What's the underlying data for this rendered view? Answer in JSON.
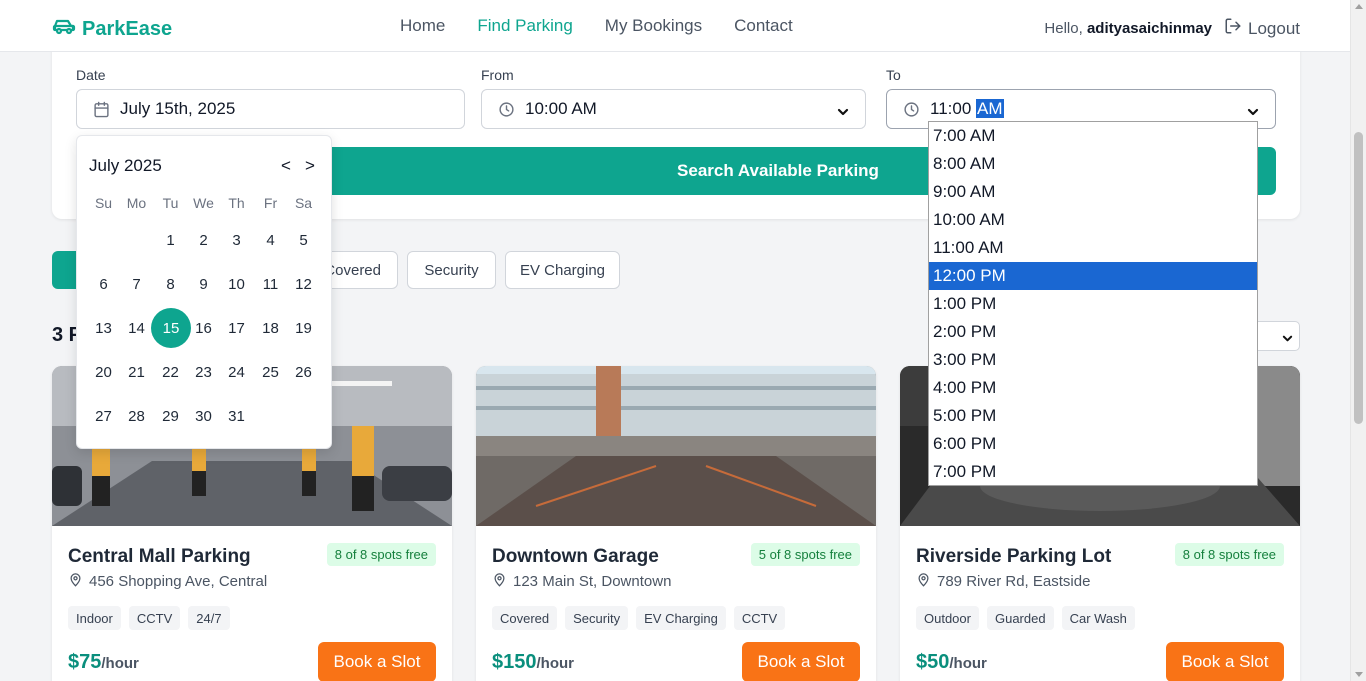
{
  "brand": {
    "name": "ParkEase",
    "icon": "car-icon"
  },
  "nav": {
    "links": [
      "Home",
      "Find Parking",
      "My Bookings",
      "Contact"
    ],
    "active": "Find Parking"
  },
  "user": {
    "greeting": "Hello,",
    "username": "adityasaichinmay",
    "logout": "Logout"
  },
  "search": {
    "date_label": "Date",
    "date_value": "July 15th, 2025",
    "from_label": "From",
    "from_value": "10:00 AM",
    "to_label": "To",
    "to_value_time": "11:00",
    "to_value_period": "AM",
    "button": "Search Available Parking"
  },
  "filters": [
    "Covered",
    "Security",
    "EV Charging"
  ],
  "results": {
    "title_fragment": "3 P"
  },
  "datepicker": {
    "month": "July 2025",
    "prev": "<",
    "next": ">",
    "weekdays": [
      "Su",
      "Mo",
      "Tu",
      "We",
      "Th",
      "Fr",
      "Sa"
    ],
    "first_weekday": 2,
    "days_in_month": 31,
    "selected": 15
  },
  "time_dropdown": {
    "options": [
      "7:00 AM",
      "8:00 AM",
      "9:00 AM",
      "10:00 AM",
      "11:00 AM",
      "12:00 PM",
      "1:00 PM",
      "2:00 PM",
      "3:00 PM",
      "4:00 PM",
      "5:00 PM",
      "6:00 PM",
      "7:00 PM"
    ],
    "highlighted": "12:00 PM"
  },
  "cards": [
    {
      "name": "Central Mall Parking",
      "availability": "8 of 8 spots free",
      "address": "456 Shopping Ave, Central",
      "tags": [
        "Indoor",
        "CCTV",
        "24/7"
      ],
      "price": "$75",
      "unit": "/hour",
      "button": "Book a Slot"
    },
    {
      "name": "Downtown Garage",
      "availability": "5 of 8 spots free",
      "address": "123 Main St, Downtown",
      "tags": [
        "Covered",
        "Security",
        "EV Charging",
        "CCTV"
      ],
      "price": "$150",
      "unit": "/hour",
      "button": "Book a Slot"
    },
    {
      "name": "Riverside Parking Lot",
      "availability": "8 of 8 spots free",
      "address": "789 River Rd, Eastside",
      "tags": [
        "Outdoor",
        "Guarded",
        "Car Wash"
      ],
      "price": "$50",
      "unit": "/hour",
      "button": "Book a Slot"
    }
  ],
  "colors": {
    "brand": "#0ea58f",
    "accent": "#f97316",
    "selection": "#1a67d2"
  }
}
